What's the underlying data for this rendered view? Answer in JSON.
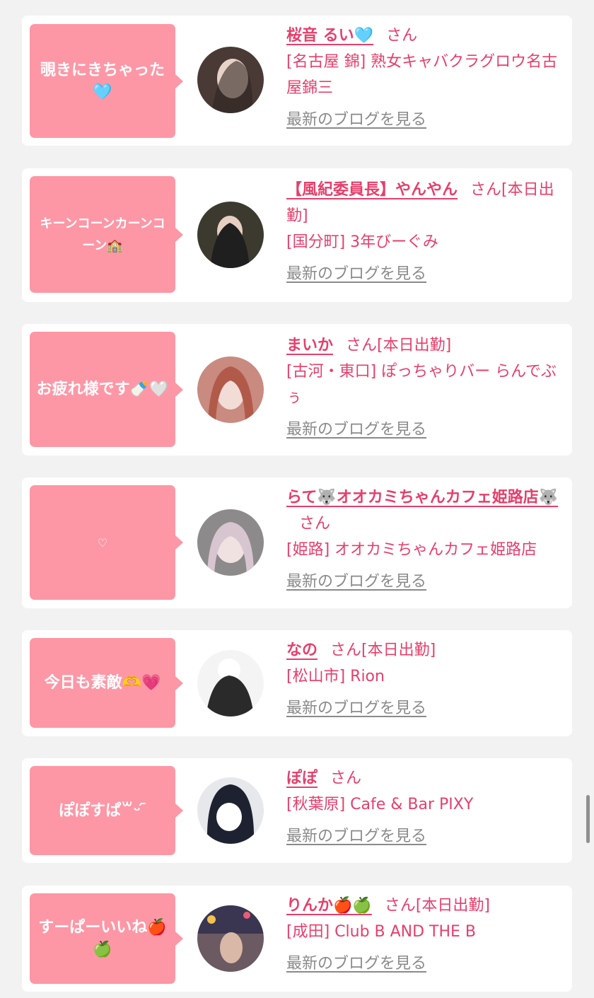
{
  "cards": [
    {
      "bubble": "覗きにきちゃった🩵",
      "name": "桜音 るい🩵",
      "san": "さん",
      "status": "",
      "shop": "[名古屋 錦] 熟女キャバクラグロウ名古屋錦三",
      "blog": "最新のブログを見る"
    },
    {
      "bubble": "キーンコーンカーンコーン🏫",
      "name": "【風紀委員長】やんやん",
      "san": "さん",
      "status": "[本日出勤]",
      "shop": "[国分町] 3年びーぐみ",
      "blog": "最新のブログを見る"
    },
    {
      "bubble": "お疲れ様です🍼🤍",
      "name": "まいか",
      "san": "さん",
      "status": "[本日出勤]",
      "shop": "[古河・東口] ぽっちゃりバー らんでぶぅ",
      "blog": "最新のブログを見る"
    },
    {
      "bubble": "♡",
      "name": "らて🐺オオカミちゃんカフェ姫路店🐺",
      "san": "さん",
      "status": "",
      "shop": "[姫路] オオカミちゃんカフェ姫路店",
      "blog": "最新のブログを見る"
    },
    {
      "bubble": "今日も素敵🫶💗",
      "name": "なの",
      "san": "さん",
      "status": "[本日出勤]",
      "shop": "[松山市] Rion",
      "blog": "最新のブログを見る"
    },
    {
      "bubble": "ぽぽすぱ꒳ᵕ ᷇ ",
      "name": "ぽぽ",
      "san": "さん",
      "status": "",
      "shop": "[秋葉原] Cafe & Bar PIXY",
      "blog": "最新のブログを見る"
    },
    {
      "bubble": "すーぱーいいね🍎🍏",
      "name": "りんか🍎🍏",
      "san": "さん",
      "status": "[本日出勤]",
      "shop": "[成田] Club B AND THE B",
      "blog": "最新のブログを見る"
    }
  ],
  "colors": {
    "accent": "#e53f6b",
    "bubble": "#fd97a6",
    "link_gray": "#8a8a8a",
    "background": "#f2f2f2"
  }
}
